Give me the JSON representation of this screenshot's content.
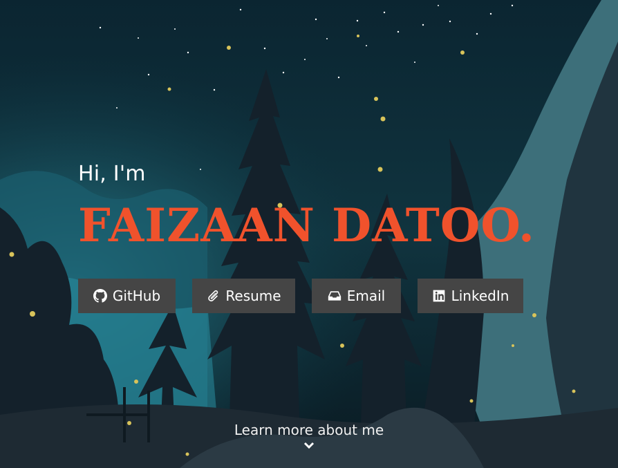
{
  "hero": {
    "greeting": "Hi, I'm",
    "name": "FAIZAAN DATOO",
    "name_period": ".",
    "name_color": "#f0522c"
  },
  "buttons": [
    {
      "label": "GitHub",
      "icon": "github-icon"
    },
    {
      "label": "Resume",
      "icon": "paperclip-icon"
    },
    {
      "label": "Email",
      "icon": "inbox-icon"
    },
    {
      "label": "LinkedIn",
      "icon": "linkedin-icon"
    }
  ],
  "footer": {
    "learn_more": "Learn more about me",
    "icon": "chevron-down-icon"
  },
  "colors": {
    "accent": "#f0522c",
    "button_bg": "#454545",
    "sky": "#0d2530"
  }
}
